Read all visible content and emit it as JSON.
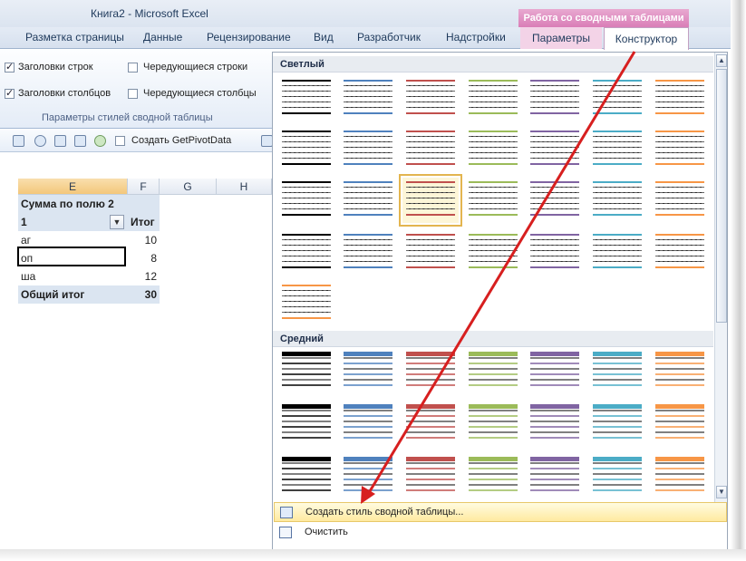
{
  "window": {
    "title": "Книга2  -  Microsoft Excel"
  },
  "context_group": {
    "label": "Работа со сводными таблицами"
  },
  "tabs": [
    "Разметка страницы",
    "Данные",
    "Рецензирование",
    "Вид",
    "Разработчик",
    "Надстройки"
  ],
  "context_tabs": {
    "params": "Параметры",
    "design": "Конструктор"
  },
  "ribbon": {
    "options": [
      {
        "label": "Заголовки строк",
        "checked": true
      },
      {
        "label": "Чередующиеся строки",
        "checked": false
      },
      {
        "label": "Заголовки столбцов",
        "checked": true
      },
      {
        "label": "Чередующиеся столбцы",
        "checked": false
      }
    ],
    "group_label": "Параметры стилей сводной таблицы"
  },
  "quickbar": {
    "getpivot_label": "Создать GetPivotData"
  },
  "sheet": {
    "columns": [
      "E",
      "F",
      "G",
      "H"
    ],
    "header_title": "Сумма по полю 2",
    "row_label": "1",
    "total_label": "Итог",
    "rows": [
      {
        "label": "аг",
        "value": "10"
      },
      {
        "label": "оп",
        "value": "8"
      },
      {
        "label": "ша",
        "value": "12"
      }
    ],
    "grand_total": {
      "label": "Общий итог",
      "value": "30"
    }
  },
  "gallery": {
    "sections": {
      "light": "Светлый",
      "medium": "Средний"
    },
    "light_colors": [
      "#000000",
      "#4f81bd",
      "#c0504d",
      "#9bbb59",
      "#8064a2",
      "#4bacc6",
      "#f79646"
    ],
    "medium_colors": [
      "#000000",
      "#4f81bd",
      "#c0504d",
      "#9bbb59",
      "#8064a2",
      "#4bacc6",
      "#f79646"
    ],
    "highlight_color": "#e3b54f"
  },
  "menu": {
    "create_style": "Создать стиль сводной таблицы...",
    "clear": "Очистить"
  },
  "annotation": {
    "arrow_color": "#d71f1f"
  }
}
